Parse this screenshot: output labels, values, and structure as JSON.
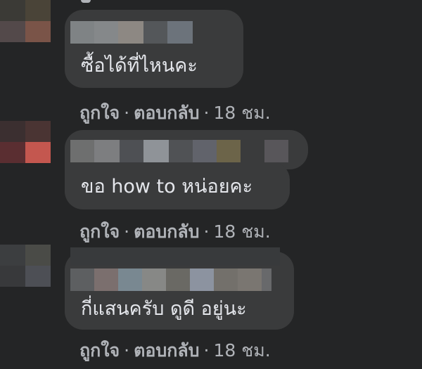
{
  "comments": [
    {
      "text": "ซื้อได้ที่ไหนคะ",
      "like_label": "ถูกใจ",
      "reply_label": "ตอบกลับ",
      "separator": "·",
      "time": "18 ชม."
    },
    {
      "text": "ขอ how to หน่อยคะ",
      "like_label": "ถูกใจ",
      "reply_label": "ตอบกลับ",
      "separator": "·",
      "time": "18 ชม."
    },
    {
      "text": "กี่แสนครับ ดูดี อยู่นะ",
      "like_label": "ถูกใจ",
      "reply_label": "ตอบกลับ",
      "separator": "·",
      "time": "18 ชม."
    }
  ],
  "colors": {
    "background": "#242526",
    "bubble": "#3a3b3c",
    "text": "#e4e6eb",
    "secondary": "#b0b3b8"
  }
}
